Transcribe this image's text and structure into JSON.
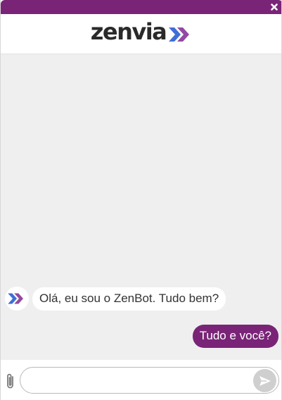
{
  "header": {
    "logo_text": "zenvia",
    "close_icon": "close-icon"
  },
  "colors": {
    "brand_purple": "#7a2478",
    "conversation_bg": "#efefef"
  },
  "conversation": {
    "messages": [
      {
        "from": "bot",
        "avatar_icon": "zenbot-avatar-icon",
        "text": "Olá, eu sou o ZenBot. Tudo bem?"
      },
      {
        "from": "user",
        "text": "Tudo e você?"
      }
    ]
  },
  "composer": {
    "attach_icon": "paperclip-icon",
    "input_value": "",
    "input_placeholder": "",
    "send_icon": "send-arrow-icon"
  }
}
